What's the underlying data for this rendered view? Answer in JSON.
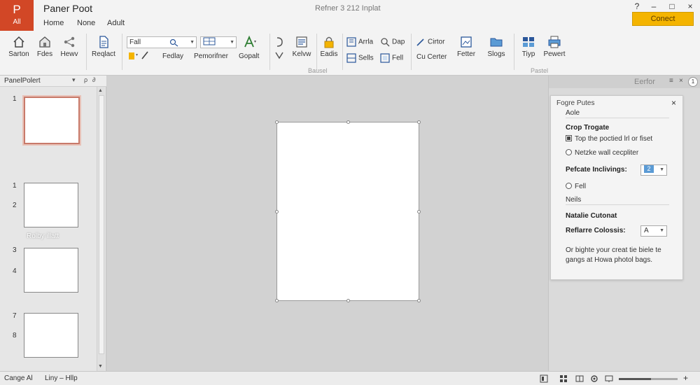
{
  "titlebar": {
    "logo_letter": "P",
    "logo_sub": "All",
    "app_name": "Paner Poot",
    "menu_tabs": [
      "Home",
      "None",
      "Adult"
    ],
    "document_title": "Refner 3 212 Inplat",
    "connect_label": "Conect",
    "win_controls": [
      "?",
      "–",
      "□",
      "×"
    ]
  },
  "ribbon": {
    "buttons": [
      {
        "label": "Sarton",
        "icon": "home-icon"
      },
      {
        "label": "Fdes",
        "icon": "folder-home-icon"
      },
      {
        "label": "Hewv",
        "icon": "share-icon"
      },
      {
        "label": "Reqlact",
        "icon": "document-icon"
      },
      {
        "label": "Fedlay",
        "icon": "font-icon"
      },
      {
        "label": "Pemorifner",
        "icon": "format-icon"
      },
      {
        "label": "Gopalt",
        "icon": "text-effect-icon"
      },
      {
        "label": "Kelvw",
        "icon": "align-icon"
      },
      {
        "label": "Eadis",
        "icon": "lock-icon"
      },
      {
        "label": "Fetter",
        "icon": "image-icon"
      },
      {
        "label": "Slogs",
        "icon": "folder-icon"
      },
      {
        "label": "Tiyp",
        "icon": "layout-icon"
      },
      {
        "label": "Pewert",
        "icon": "print-icon"
      }
    ],
    "font_name": "Fall",
    "font_style": "",
    "small_buttons": [
      "Arrla",
      "Dap",
      "Sells",
      "Fell",
      "Cirtor",
      "Cu Certer"
    ],
    "group_labels": [
      "Bausel",
      "Pastel"
    ]
  },
  "thumbpane": {
    "header": "PanelPolert",
    "header_controls": [
      "▾",
      "ρ",
      "∂"
    ],
    "slide_numbers": [
      "1",
      "1",
      "2",
      "3",
      "4",
      "7",
      "8"
    ],
    "caption": "Rolby illatt"
  },
  "dock": {
    "title": "Eerfor",
    "controls": [
      "≡",
      "×"
    ],
    "badge": "1"
  },
  "format_panel": {
    "title": "Fogre Putes",
    "sub_title": "Aole",
    "close": "×",
    "section1_heading": "Crop Trogate",
    "checkbox1_label": "Top the poctied lrl or fiset",
    "checkbox1_checked": true,
    "radio1_label": "Netzke wall cecpliter",
    "field1_label": "Pefcate Inclivings:",
    "field1_value": "2",
    "radio2_label": "Fell",
    "section2_heading": "Neils",
    "section3_heading": "Natalie Cutonat",
    "field2_label": "Reflarre Colossis:",
    "field2_value": "A",
    "help_text": "Or bighte your creat tie biele te gangs at Howa photol bags."
  },
  "statusbar": {
    "left_label": "Cange Al",
    "help_label": "Liny – Hllp",
    "zoom_plus": "+",
    "zoom_level": 0.55,
    "icons": [
      "normal-view-icon",
      "slide-sorter-icon",
      "reading-view-icon",
      "settings-icon",
      "slideshow-icon"
    ]
  }
}
